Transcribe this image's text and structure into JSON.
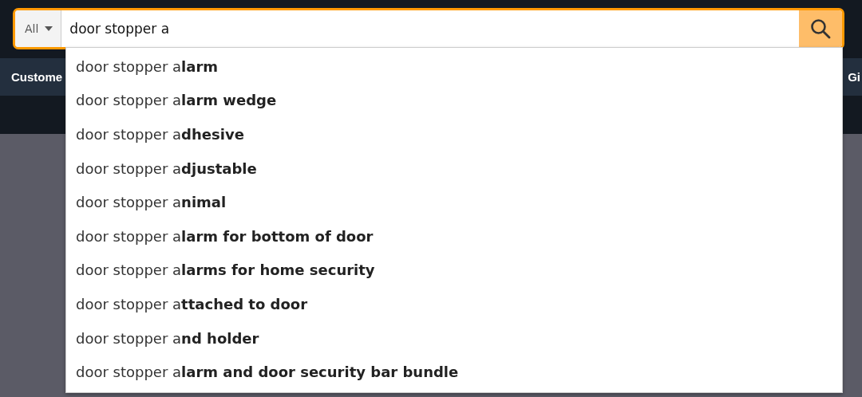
{
  "search": {
    "category": "All",
    "value": "door stopper a"
  },
  "nav": {
    "items": [
      {
        "label": "Custome"
      },
      {
        "label": "Gi"
      }
    ]
  },
  "suggestions": [
    {
      "text": "door stopper a**larm**"
    },
    {
      "text": "door stopper a**larm wedge**"
    },
    {
      "text": "door stopper a**dhesive**"
    },
    {
      "text": "door stopper a**djustable**"
    },
    {
      "text": "door stopper a**nimal**"
    },
    {
      "text": "door stopper a**larm for bottom of door**"
    },
    {
      "text": "door stopper a**larms for home security**"
    },
    {
      "text": "door stopper a**ttached to door**"
    },
    {
      "text": "door stopper a**nd holder**"
    },
    {
      "text": "door stopper a**larm and door security bar bundle**"
    }
  ]
}
